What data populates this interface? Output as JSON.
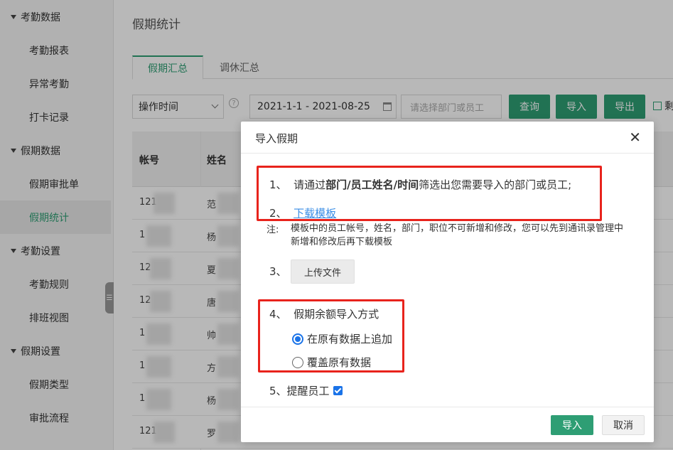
{
  "sidebar": {
    "groups": [
      {
        "label": "考勤数据",
        "items": [
          "考勤报表",
          "异常考勤",
          "打卡记录"
        ]
      },
      {
        "label": "假期数据",
        "items": [
          "假期审批单",
          "假期统计"
        ]
      },
      {
        "label": "考勤设置",
        "items": [
          "考勤规则",
          "排班视图"
        ]
      },
      {
        "label": "假期设置",
        "items": [
          "假期类型",
          "审批流程"
        ]
      }
    ],
    "active_item": "假期统计",
    "handle_icon": "menu-icon"
  },
  "page": {
    "title": "假期统计",
    "tabs": [
      {
        "label": "假期汇总",
        "active": true
      },
      {
        "label": "调休汇总",
        "active": false
      }
    ]
  },
  "toolbar": {
    "select_value": "操作时间",
    "date_range": "2021-1-1 - 2021-08-25",
    "picker_placeholder": "请选择部门或员工",
    "query_label": "查询",
    "import_label": "导入",
    "export_label": "导出",
    "checkbox_label_partial": "剩"
  },
  "table": {
    "headers": [
      "帐号",
      "姓名"
    ],
    "rows": [
      {
        "account": "121",
        "name": "范"
      },
      {
        "account": "1",
        "name": "杨"
      },
      {
        "account": "12",
        "name": "夏"
      },
      {
        "account": "12",
        "name": "唐"
      },
      {
        "account": "1",
        "name": "帅"
      },
      {
        "account": "1",
        "name": "方"
      },
      {
        "account": "1",
        "name": "杨"
      },
      {
        "account": "121",
        "name": "罗"
      }
    ]
  },
  "modal": {
    "title": "导入假期",
    "step1_num": "1、",
    "step1_pre": "请通过",
    "step1_bold": "部门/员工姓名/时间",
    "step1_post": "筛选出您需要导入的部门或员工;",
    "step2_num": "2、",
    "step2_link": "下载模板",
    "note_label": "注:",
    "note_text": "模板中的员工帐号，姓名，部门，职位不可新增和修改，您可以先到通讯录管理中新增和修改后再下载模板",
    "step3_num": "3、",
    "upload_label": "上传文件",
    "step4_num": "4、",
    "step4_label": "假期余额导入方式",
    "radio_options": [
      {
        "label": "在原有数据上追加",
        "checked": true
      },
      {
        "label": "覆盖原有数据",
        "checked": false
      }
    ],
    "step5_label": "5、提醒员工",
    "step5_checked": true,
    "import_button": "导入",
    "cancel_button": "取消"
  },
  "colors": {
    "accent_green": "#2e9e74",
    "highlight_red": "#e8231c",
    "link_blue": "#3a8ee6",
    "radio_blue": "#1a73e8"
  }
}
